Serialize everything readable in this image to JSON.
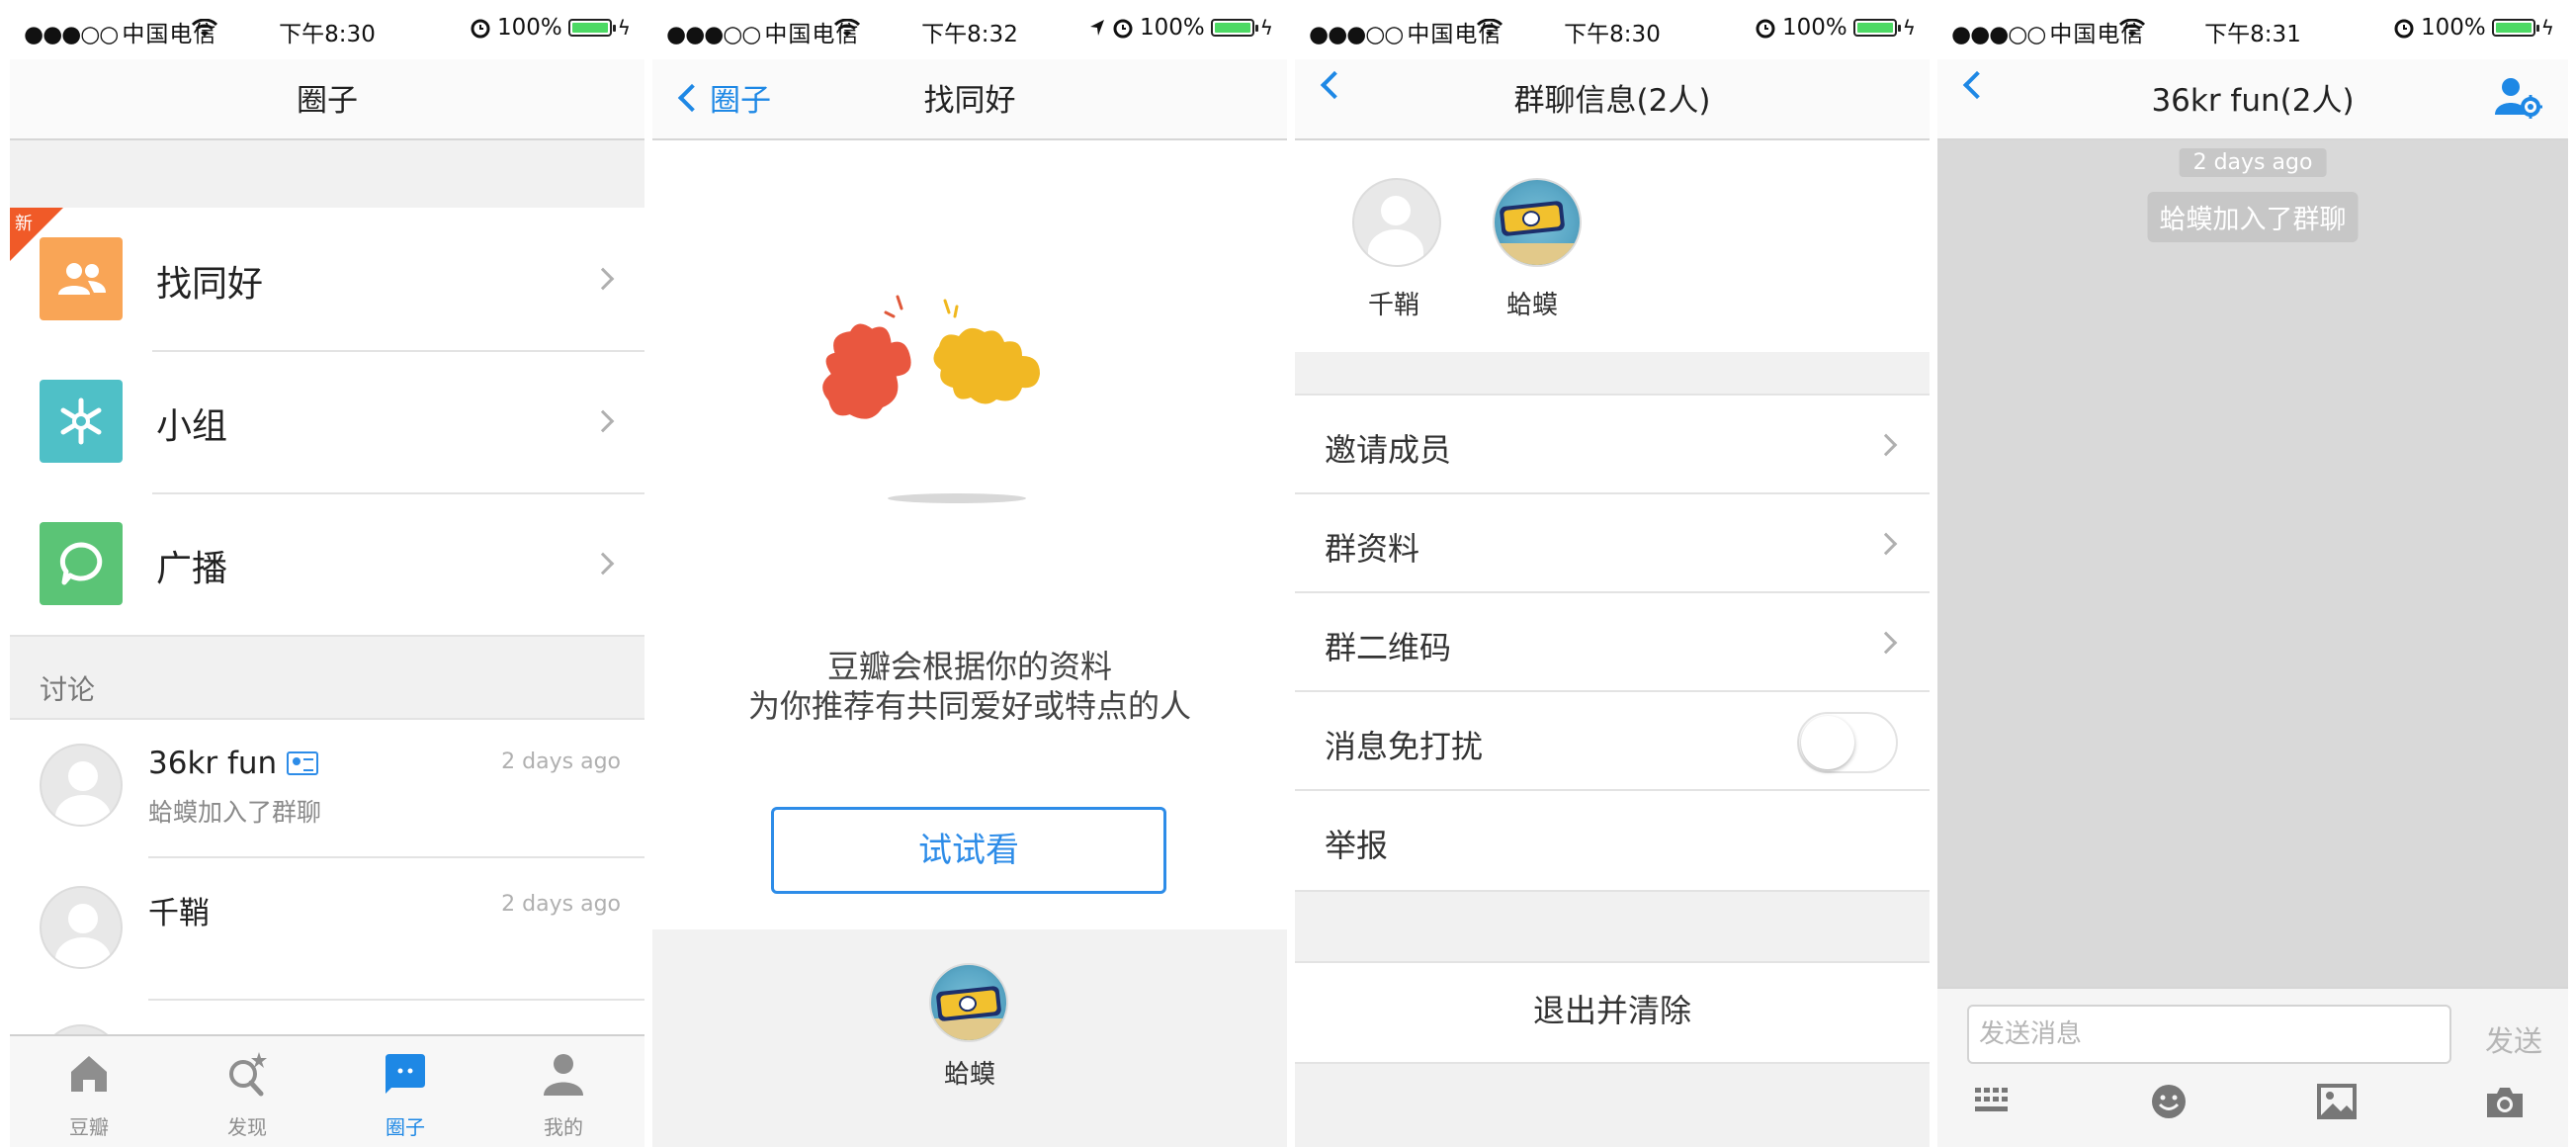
{
  "status": {
    "carrier_dots": "●●●○○",
    "carrier": "中国电信",
    "battery": "100%",
    "times": [
      "下午8:30",
      "下午8:32",
      "下午8:30",
      "下午8:31"
    ],
    "battery_color": "#4cd964"
  },
  "accent": "#1e88e5",
  "screen1": {
    "title": "圈子",
    "new_badge": "新",
    "menu": [
      {
        "label": "找同好",
        "icon": "people-icon",
        "color": "#f9a556"
      },
      {
        "label": "小组",
        "icon": "snowflake-icon",
        "color": "#4fc0c7"
      },
      {
        "label": "广播",
        "icon": "speech-bubble-icon",
        "color": "#5bc476"
      }
    ],
    "section": "讨论",
    "conversations": [
      {
        "name": "36kr fun",
        "snippet": "蛤蟆加入了群聊",
        "time": "2 days ago"
      },
      {
        "name": "千鞘",
        "snippet": "",
        "time": "2 days ago"
      }
    ],
    "tabs": [
      {
        "label": "豆瓣",
        "icon": "home-icon"
      },
      {
        "label": "发现",
        "icon": "search-star-icon"
      },
      {
        "label": "圈子",
        "icon": "chat-bubble-icon",
        "active": true
      },
      {
        "label": "我的",
        "icon": "person-icon"
      }
    ]
  },
  "screen2": {
    "back": "圈子",
    "title": "找同好",
    "tip_line1": "豆瓣会根据你的资料",
    "tip_line2": "为你推荐有共同爱好或特点的人",
    "try_button": "试试看",
    "suggested_name": "蛤蟆"
  },
  "screen3": {
    "title": "群聊信息(2人)",
    "members": [
      {
        "name": "千鞘",
        "avatar": "default-avatar"
      },
      {
        "name": "蛤蟆",
        "avatar": "onepiece-avatar"
      }
    ],
    "rows": [
      {
        "label": "邀请成员",
        "type": "chevron"
      },
      {
        "label": "群资料",
        "type": "chevron"
      },
      {
        "label": "群二维码",
        "type": "chevron"
      },
      {
        "label": "消息免打扰",
        "type": "toggle",
        "on": false
      },
      {
        "label": "举报",
        "type": "none"
      }
    ],
    "exit_button": "退出并清除"
  },
  "screen4": {
    "title": "36kr fun(2人)",
    "time_label": "2 days ago",
    "system_message": "蛤蟆加入了群聊",
    "input_placeholder": "发送消息",
    "send": "发送",
    "tools": [
      "keyboard-icon",
      "emoji-icon",
      "image-icon",
      "camera-icon"
    ]
  }
}
